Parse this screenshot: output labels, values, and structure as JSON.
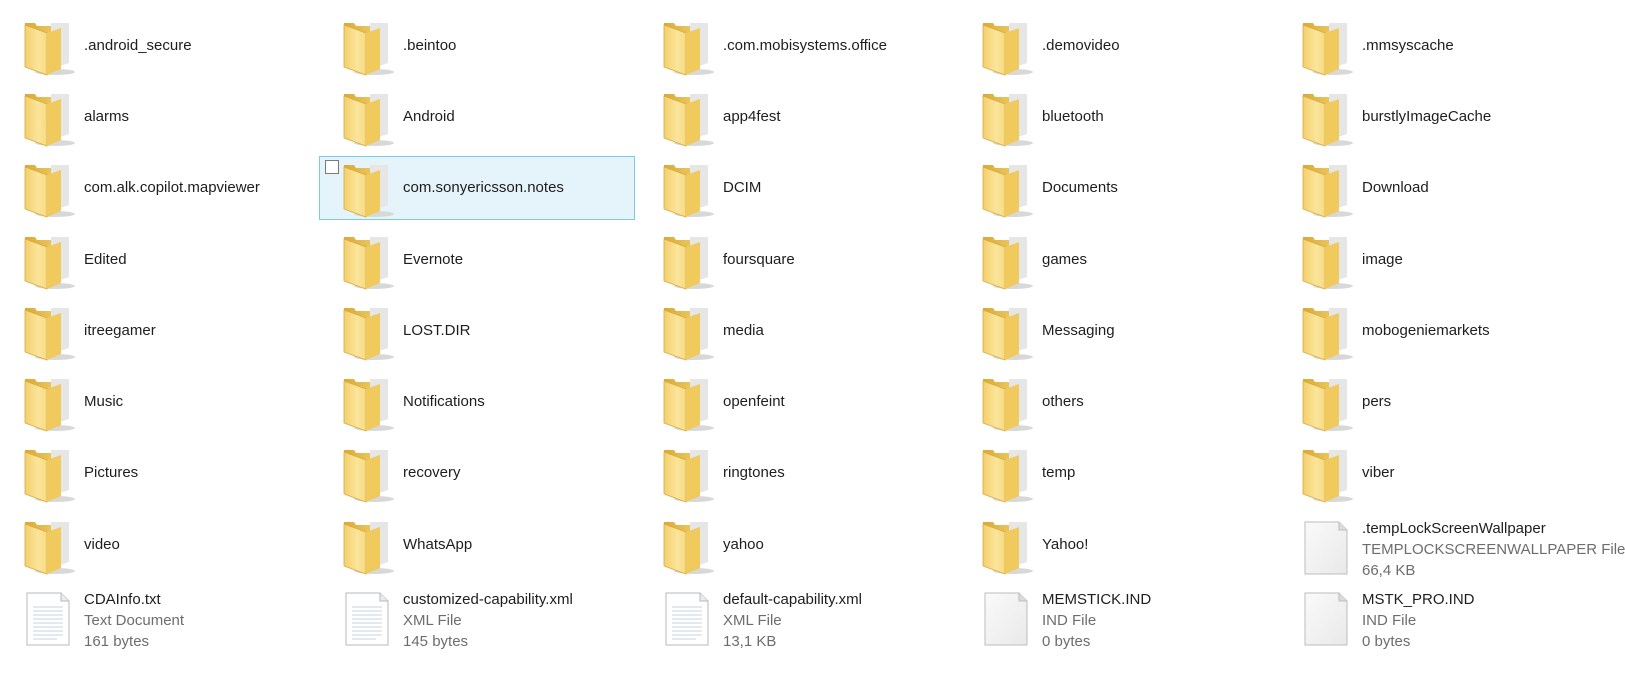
{
  "window": {
    "view": "Tiles"
  },
  "colors": {
    "folder_back": "#e9c24f",
    "folder_front": "#f8dd84",
    "selection_bg": "#e5f3fb",
    "selection_border": "#7ccbe8",
    "meta_text": "#6d6d6d"
  },
  "items": [
    {
      "kind": "folder",
      "name": ".android_secure"
    },
    {
      "kind": "folder",
      "name": ".beintoo"
    },
    {
      "kind": "folder",
      "name": ".com.mobisystems.office"
    },
    {
      "kind": "folder",
      "name": ".demovideo"
    },
    {
      "kind": "folder",
      "name": ".mmsyscache"
    },
    {
      "kind": "folder",
      "name": "alarms"
    },
    {
      "kind": "folder",
      "name": "Android"
    },
    {
      "kind": "folder",
      "name": "app4fest"
    },
    {
      "kind": "folder",
      "name": "bluetooth"
    },
    {
      "kind": "folder",
      "name": "burstlyImageCache"
    },
    {
      "kind": "folder",
      "name": "com.alk.copilot.mapviewer"
    },
    {
      "kind": "folder",
      "name": "com.sonyericsson.notes",
      "selected": true
    },
    {
      "kind": "folder",
      "name": "DCIM"
    },
    {
      "kind": "folder",
      "name": "Documents"
    },
    {
      "kind": "folder",
      "name": "Download"
    },
    {
      "kind": "folder",
      "name": "Edited"
    },
    {
      "kind": "folder",
      "name": "Evernote"
    },
    {
      "kind": "folder",
      "name": "foursquare"
    },
    {
      "kind": "folder",
      "name": "games"
    },
    {
      "kind": "folder",
      "name": "image"
    },
    {
      "kind": "folder",
      "name": "itreegamer"
    },
    {
      "kind": "folder",
      "name": "LOST.DIR"
    },
    {
      "kind": "folder",
      "name": "media"
    },
    {
      "kind": "folder",
      "name": "Messaging"
    },
    {
      "kind": "folder",
      "name": "mobogeniemarkets"
    },
    {
      "kind": "folder",
      "name": "Music"
    },
    {
      "kind": "folder",
      "name": "Notifications"
    },
    {
      "kind": "folder",
      "name": "openfeint"
    },
    {
      "kind": "folder",
      "name": "others"
    },
    {
      "kind": "folder",
      "name": "pers"
    },
    {
      "kind": "folder",
      "name": "Pictures"
    },
    {
      "kind": "folder",
      "name": "recovery"
    },
    {
      "kind": "folder",
      "name": "ringtones"
    },
    {
      "kind": "folder",
      "name": "temp"
    },
    {
      "kind": "folder",
      "name": "viber"
    },
    {
      "kind": "folder",
      "name": "video"
    },
    {
      "kind": "folder",
      "name": "WhatsApp"
    },
    {
      "kind": "folder",
      "name": "yahoo"
    },
    {
      "kind": "folder",
      "name": "Yahoo!"
    },
    {
      "kind": "file",
      "icon": "blank-file-icon",
      "name": ".tempLockScreenWallpaper",
      "type": "TEMPLOCKSCREENWALLPAPER File",
      "size": "66,4 KB"
    },
    {
      "kind": "file",
      "icon": "text-file-icon",
      "name": "CDAInfo.txt",
      "type": "Text Document",
      "size": "161 bytes"
    },
    {
      "kind": "file",
      "icon": "text-file-icon",
      "name": "customized-capability.xml",
      "type": "XML File",
      "size": "145 bytes"
    },
    {
      "kind": "file",
      "icon": "text-file-icon",
      "name": "default-capability.xml",
      "type": "XML File",
      "size": "13,1 KB"
    },
    {
      "kind": "file",
      "icon": "blank-file-icon",
      "name": "MEMSTICK.IND",
      "type": "IND File",
      "size": "0 bytes"
    },
    {
      "kind": "file",
      "icon": "blank-file-icon",
      "name": "MSTK_PRO.IND",
      "type": "IND File",
      "size": "0 bytes"
    }
  ]
}
